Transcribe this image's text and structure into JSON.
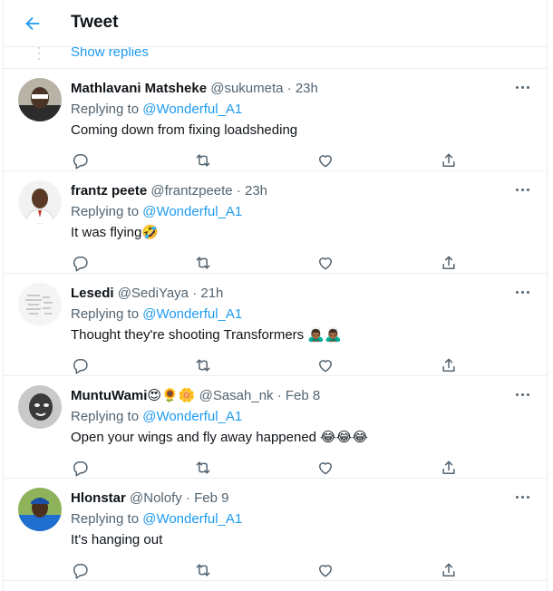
{
  "header": {
    "title": "Tweet",
    "back_icon": "arrow-left-icon"
  },
  "thread": {
    "show_replies_label": "Show replies"
  },
  "accent_color": "#1d9bf0",
  "tweets": [
    {
      "name": "Mathlavani Matsheke",
      "handle": "@sukumeta",
      "separator": "·",
      "time": "23h",
      "replying_prefix": "Replying to",
      "replying_to": "@Wonderful_A1",
      "text": "Coming down from fixing loadsheding"
    },
    {
      "name": "frantz peete",
      "handle": "@frantzpeete",
      "separator": "·",
      "time": "23h",
      "replying_prefix": "Replying to",
      "replying_to": "@Wonderful_A1",
      "text": "It was flying🤣"
    },
    {
      "name": "Lesedi",
      "handle": "@SediYaya",
      "separator": "·",
      "time": "21h",
      "replying_prefix": "Replying to",
      "replying_to": "@Wonderful_A1",
      "text": "Thought they're shooting Transformers 🙇🏾‍♂️🙇🏾‍♂️"
    },
    {
      "name": "MuntuWami😍🌻🌼",
      "handle": "@Sasah_nk",
      "separator": "·",
      "time": "Feb 8",
      "replying_prefix": "Replying to",
      "replying_to": "@Wonderful_A1",
      "text": "Open your wings and fly away happened 😂😂😂"
    },
    {
      "name": "Hlonstar",
      "handle": "@Nolofy",
      "separator": "·",
      "time": "Feb 9",
      "replying_prefix": "Replying to",
      "replying_to": "@Wonderful_A1",
      "text": "It's hanging out"
    }
  ],
  "action_icons": [
    "reply-icon",
    "retweet-icon",
    "like-icon",
    "share-icon"
  ]
}
